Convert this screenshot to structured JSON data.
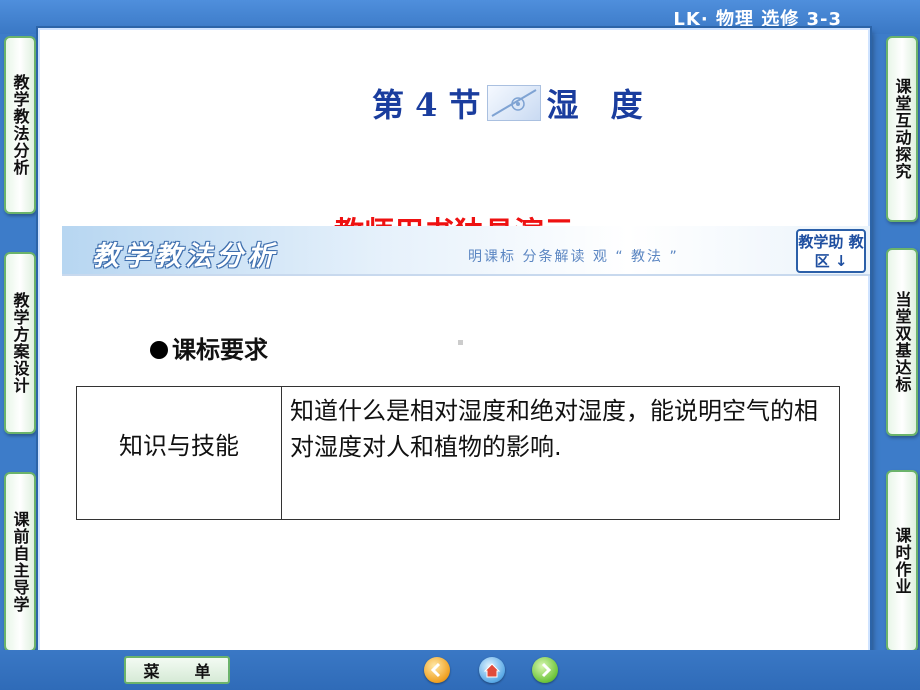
{
  "header": {
    "course": "LK· 物理  选修  3-3"
  },
  "left_nav": [
    {
      "label": "教学教法分析"
    },
    {
      "label": "教学方案设计"
    },
    {
      "label": "课前自主导学"
    }
  ],
  "right_nav": [
    {
      "label": "课堂互动探究"
    },
    {
      "label": "当堂双基达标"
    },
    {
      "label": "课时作业"
    }
  ],
  "lesson": {
    "section": "第 4 节",
    "topic": "湿　度",
    "subtitle": "教师用书独具演示"
  },
  "banner": {
    "title": "教学教法分析",
    "subtitle": "明课标  分条解读  观 “ 教法 ”",
    "help_label": "教学助 教区 ↓"
  },
  "requirements": {
    "heading": "课标要求",
    "rows": [
      {
        "category": "知识与技能",
        "content": "知道什么是相对湿度和绝对湿度，能说明空气的相对湿度对人和植物的影响."
      }
    ]
  },
  "footer": {
    "menu_left": "菜",
    "menu_right": "单",
    "nav_icons": [
      "back-icon",
      "home-icon",
      "forward-icon"
    ]
  },
  "colors": {
    "background": "#3d7cc9",
    "title_blue": "#1a3d9e",
    "subtitle_red": "#ee1111",
    "tab_border": "#6bb36b"
  }
}
